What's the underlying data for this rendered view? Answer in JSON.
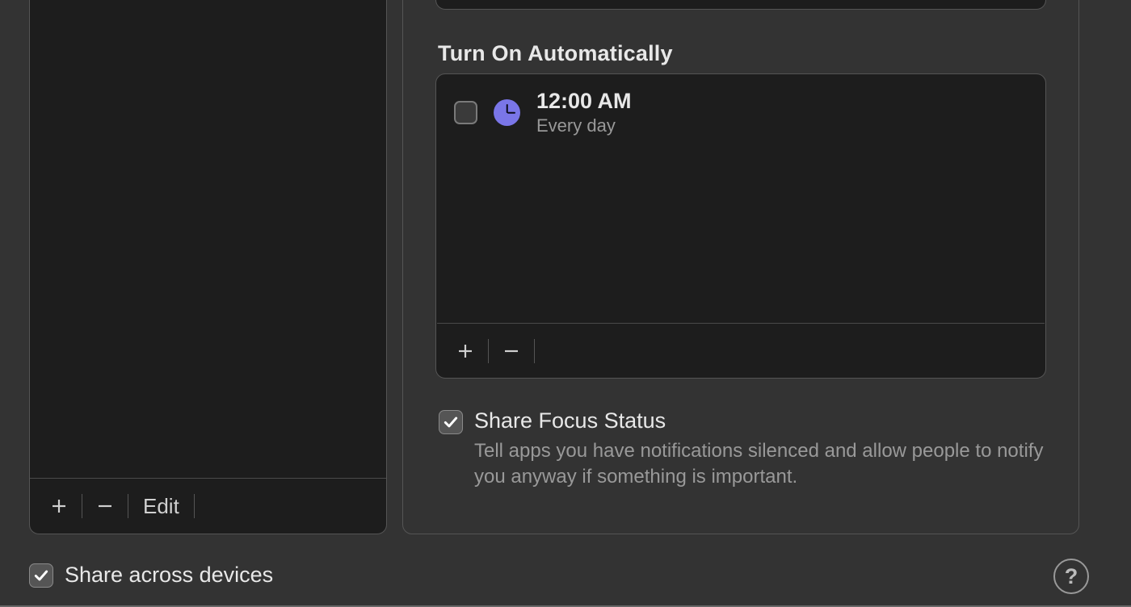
{
  "left": {
    "edit_label": "Edit"
  },
  "section": {
    "header": "Turn On Automatically"
  },
  "schedule": {
    "time": "12:00 AM",
    "repeat": "Every day"
  },
  "share_focus": {
    "title": "Share Focus Status",
    "desc": "Tell apps you have notifications silenced and allow people to notify you anyway if something is important."
  },
  "share_devices": {
    "label": "Share across devices"
  },
  "help": {
    "label": "?"
  }
}
